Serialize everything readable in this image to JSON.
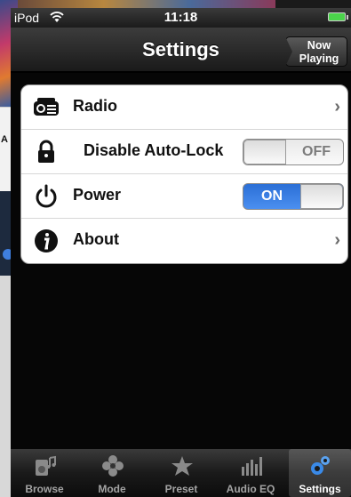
{
  "status_bar": {
    "carrier": "iPod",
    "time": "11:18"
  },
  "nav": {
    "title": "Settings",
    "now_playing_line1": "Now",
    "now_playing_line2": "Playing"
  },
  "settings": {
    "radio": "Radio",
    "autolock": "Disable Auto-Lock",
    "autolock_state": "OFF",
    "power": "Power",
    "power_state": "ON",
    "about": "About"
  },
  "tabs": {
    "browse": "Browse",
    "mode": "Mode",
    "preset": "Preset",
    "audio_eq": "Audio EQ",
    "settings": "Settings"
  },
  "background_peek": {
    "letter": "A"
  },
  "colors": {
    "accent": "#3a7fe6",
    "battery": "#4bd34b"
  }
}
